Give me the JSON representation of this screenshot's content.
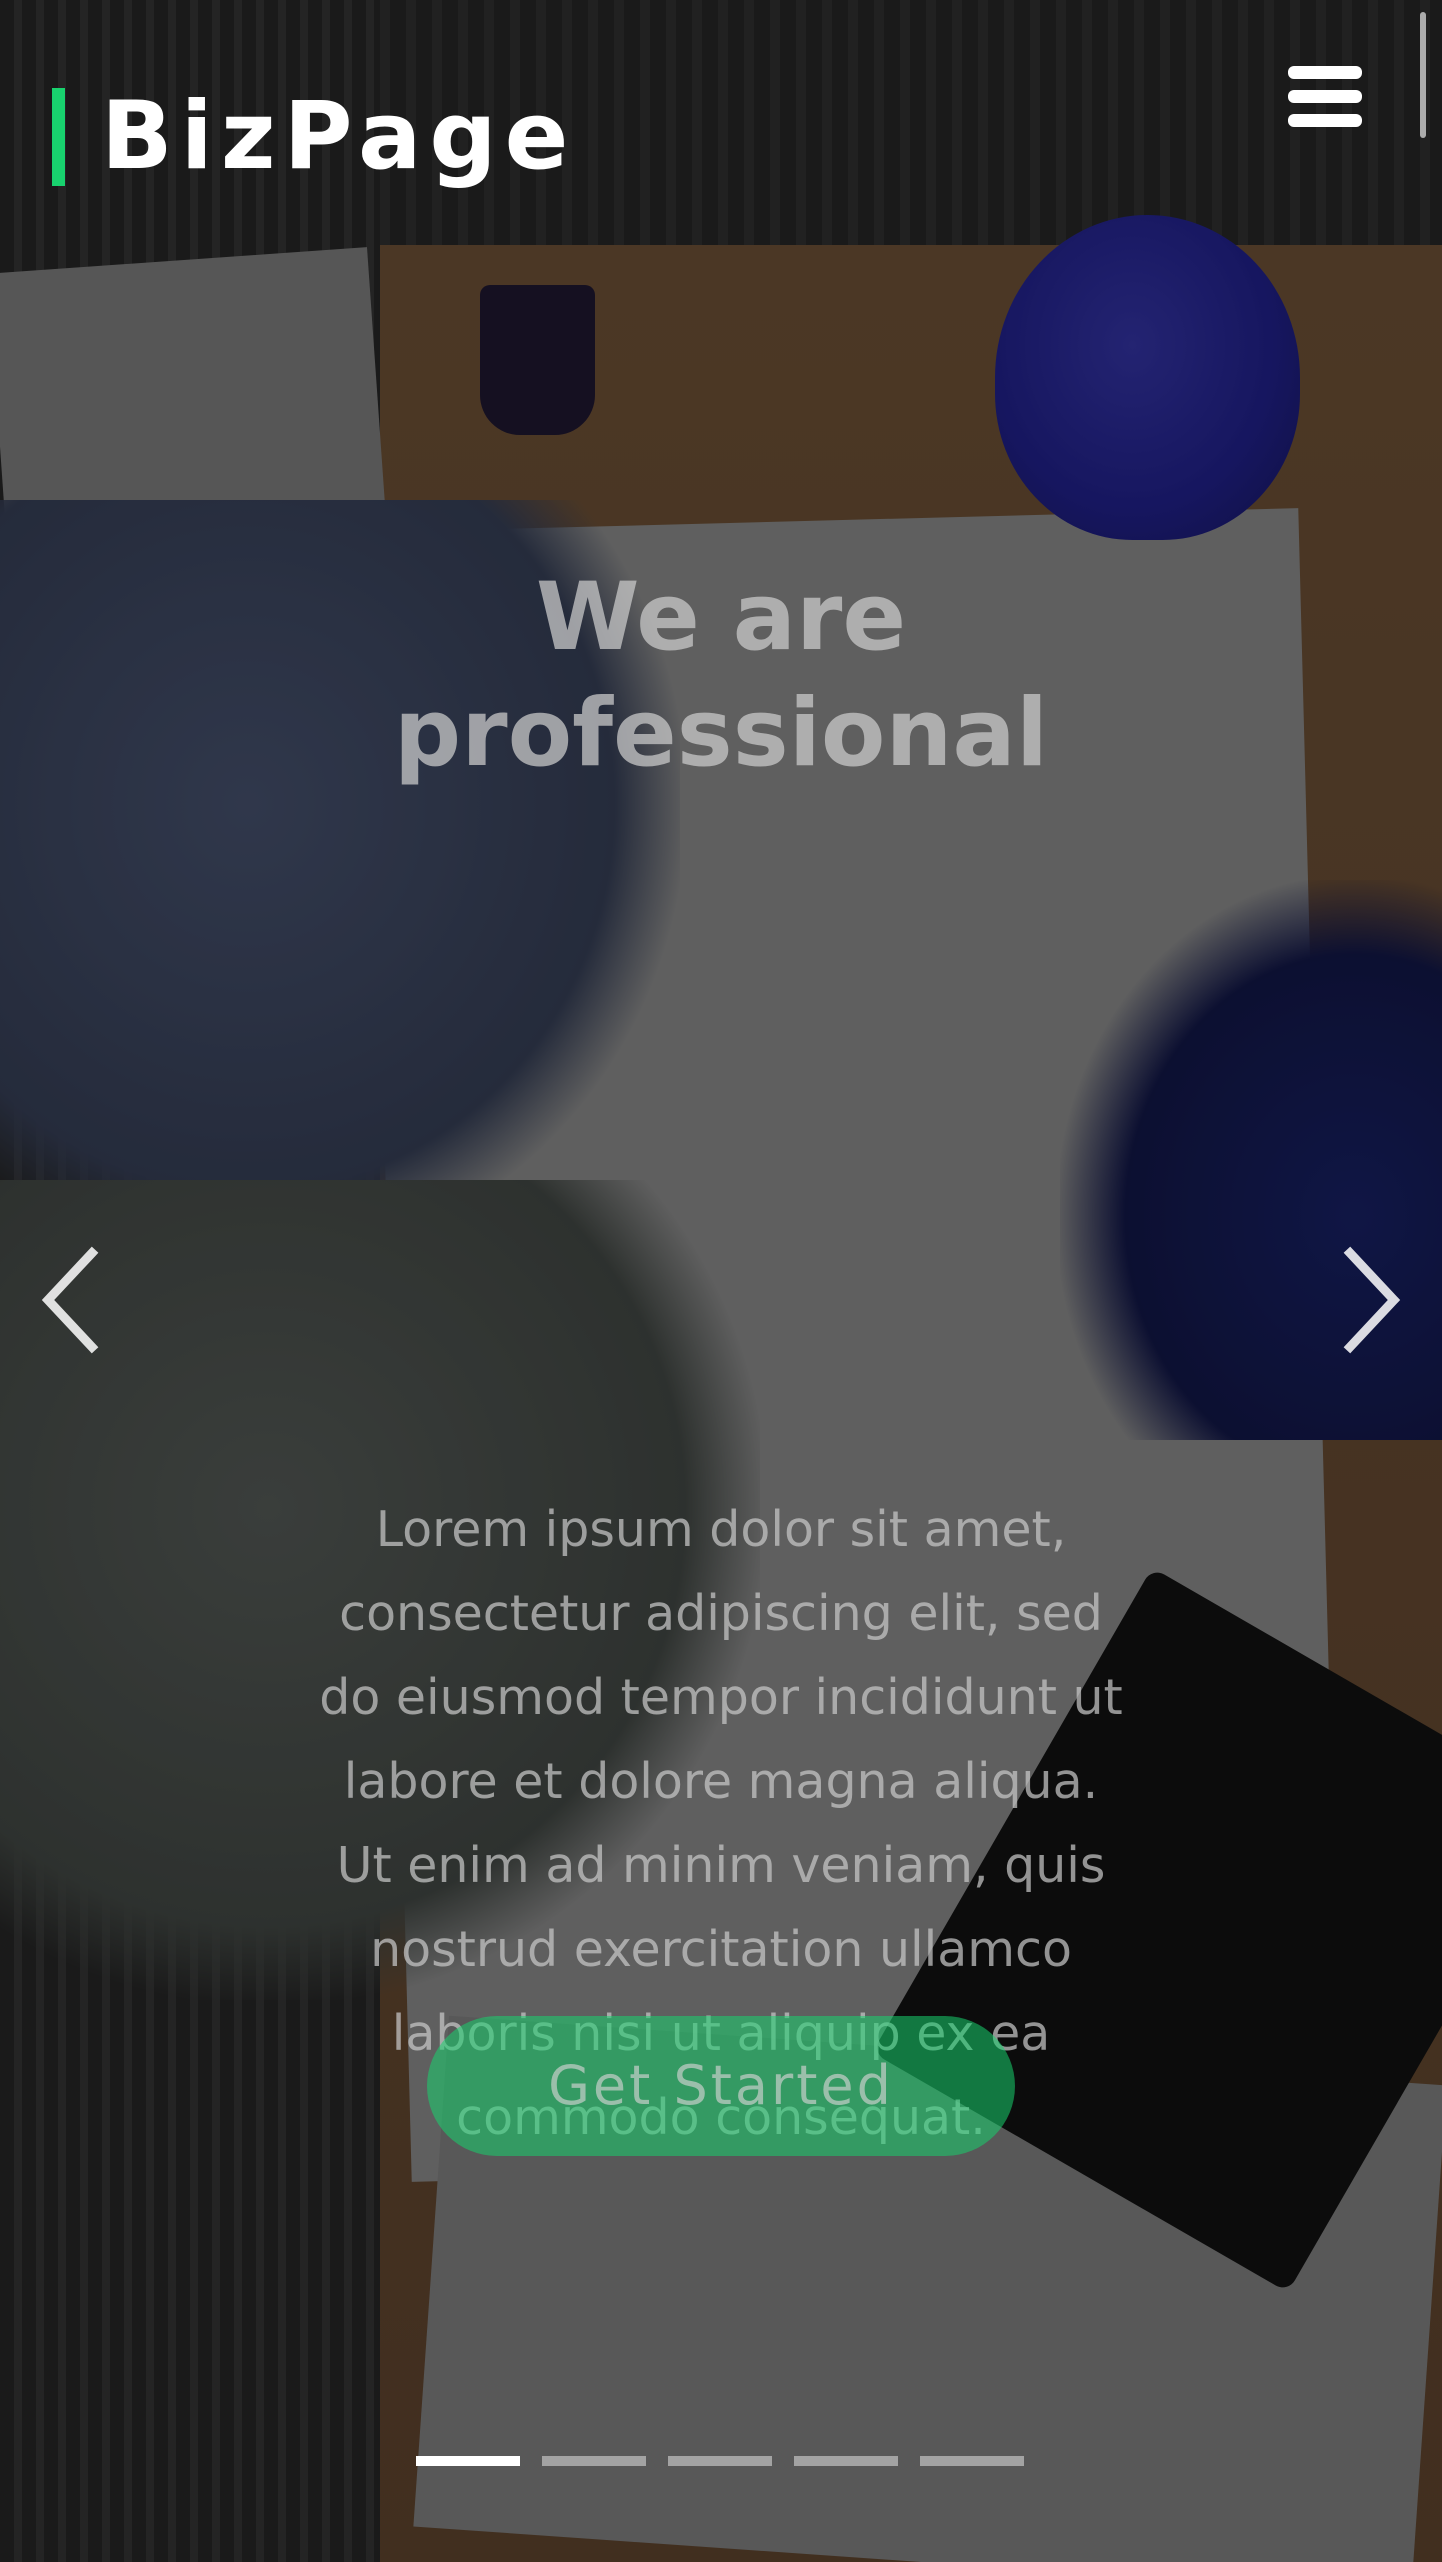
{
  "header": {
    "logo_text": "BizPage",
    "menu_icon": "hamburger-menu-icon"
  },
  "hero": {
    "title": "We are professional",
    "description": "Lorem ipsum dolor sit amet, consectetur adipiscing elit, sed do eiusmod tempor incididunt ut labore et dolore magna aliqua. Ut enim ad minim veniam, quis nostrud exercitation ullamco laboris nisi ut aliquip ex ea commodo consequat.",
    "cta_label": "Get Started"
  },
  "carousel": {
    "prev_icon": "chevron-left-icon",
    "next_icon": "chevron-right-icon",
    "slide_count": 5,
    "active_index": 0
  },
  "colors": {
    "accent": "#18d26e",
    "text": "#ffffff"
  }
}
